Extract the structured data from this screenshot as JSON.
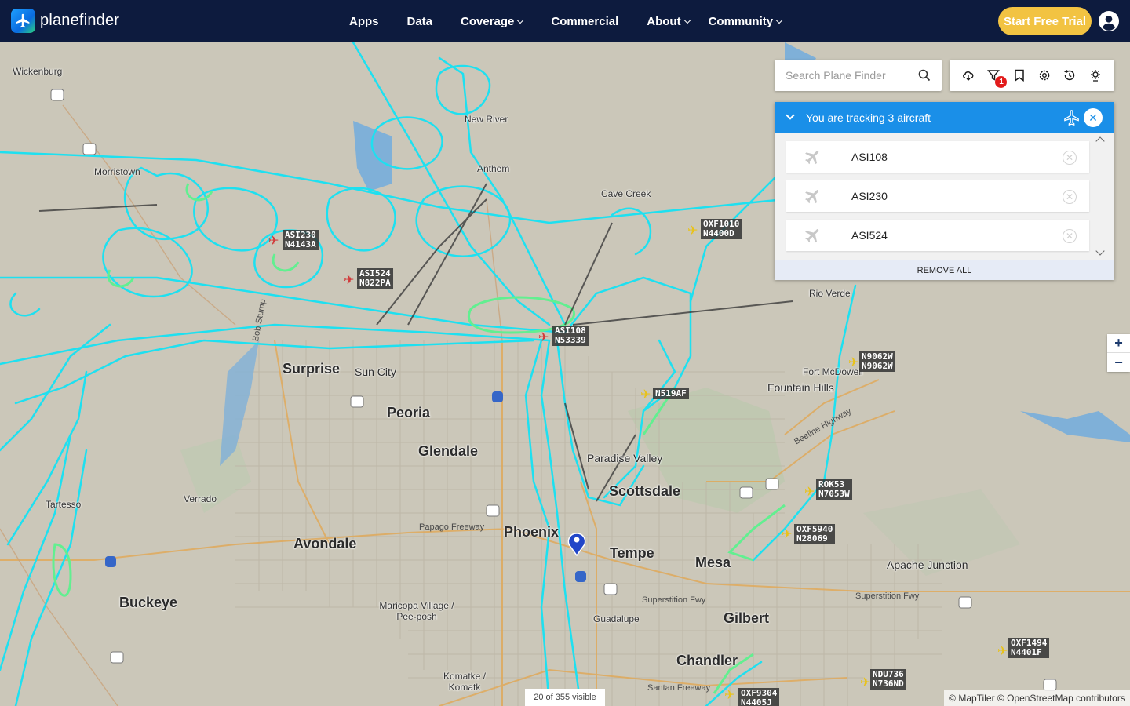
{
  "header": {
    "brand": "planefinder",
    "nav": [
      {
        "label": "Apps",
        "dropdown": false
      },
      {
        "label": "Data",
        "dropdown": false
      },
      {
        "label": "Coverage",
        "dropdown": true
      },
      {
        "label": "Commercial",
        "dropdown": false
      },
      {
        "label": "About",
        "dropdown": true
      },
      {
        "label": "Community",
        "dropdown": true
      }
    ],
    "trial_button": "Start Free Trial",
    "account_icon": "user-circle-icon"
  },
  "search": {
    "placeholder": "Search Plane Finder"
  },
  "toolbar": {
    "icons": [
      "cloud-icon",
      "filter-icon",
      "bookmark-icon",
      "settings-icon",
      "history-icon",
      "weather-icon"
    ],
    "filter_badge": "1"
  },
  "tracking": {
    "title": "You are tracking 3 aircraft",
    "items": [
      {
        "label": "ASI108"
      },
      {
        "label": "ASI230"
      },
      {
        "label": "ASI524"
      }
    ],
    "remove_all": "REMOVE ALL"
  },
  "map": {
    "cities": [
      {
        "name": "Wickenburg",
        "size": "small"
      },
      {
        "name": "New River",
        "size": "small"
      },
      {
        "name": "Morristown",
        "size": "small"
      },
      {
        "name": "Anthem",
        "size": "small"
      },
      {
        "name": "Cave Creek",
        "size": "small"
      },
      {
        "name": "Rio Verde",
        "size": "small"
      },
      {
        "name": "Fort McDowell",
        "size": "small"
      },
      {
        "name": "Fountain Hills",
        "size": "mid"
      },
      {
        "name": "Surprise",
        "size": "big"
      },
      {
        "name": "Sun City",
        "size": "mid"
      },
      {
        "name": "Peoria",
        "size": "big"
      },
      {
        "name": "Glendale",
        "size": "big"
      },
      {
        "name": "Paradise Valley",
        "size": "mid"
      },
      {
        "name": "Scottsdale",
        "size": "big"
      },
      {
        "name": "Tartesso",
        "size": "small"
      },
      {
        "name": "Verrado",
        "size": "small"
      },
      {
        "name": "Avondale",
        "size": "big"
      },
      {
        "name": "Phoenix",
        "size": "big"
      },
      {
        "name": "Tempe",
        "size": "big"
      },
      {
        "name": "Mesa",
        "size": "big"
      },
      {
        "name": "Apache Junction",
        "size": "mid"
      },
      {
        "name": "Buckeye",
        "size": "big"
      },
      {
        "name": "Maricopa Village / Pee-posh",
        "size": "small"
      },
      {
        "name": "Guadalupe",
        "size": "small"
      },
      {
        "name": "Gilbert",
        "size": "big"
      },
      {
        "name": "Chandler",
        "size": "big"
      },
      {
        "name": "Komatke / Komatk",
        "size": "small"
      }
    ],
    "road_labels": [
      "Papago Freeway",
      "Superstition Fwy",
      "Superstition Fwy",
      "Santan Freeway",
      "Bob Stump",
      "Beeline Highway"
    ],
    "aircraft": [
      {
        "callsign": "ASI230",
        "reg": "N4143A",
        "color": "#d13b3b"
      },
      {
        "callsign": "ASI524",
        "reg": "N822PA",
        "color": "#d13b3b"
      },
      {
        "callsign": "ASI108",
        "reg": "N53339",
        "color": "#d13b3b"
      },
      {
        "callsign": "OXF1010",
        "reg": "N4400D",
        "color": "#e8c21a"
      },
      {
        "callsign": "N9062W",
        "reg": "N9062W",
        "color": "#e8c21a"
      },
      {
        "callsign": "N519AF",
        "reg": "",
        "color": "#e8c21a"
      },
      {
        "callsign": "ROK53",
        "reg": "N7053W",
        "color": "#e8c21a"
      },
      {
        "callsign": "OXF5940",
        "reg": "N28069",
        "color": "#e8c21a"
      },
      {
        "callsign": "OXF1494",
        "reg": "N4401F",
        "color": "#e8c21a"
      },
      {
        "callsign": "NDU736",
        "reg": "N736ND",
        "color": "#e8c21a"
      },
      {
        "callsign": "OXF9304",
        "reg": "N4405J",
        "color": "#e8c21a"
      }
    ],
    "track_color": "#19e3f0",
    "track_color_low": "#5cf08a",
    "visible_count": "20 of 355 visible",
    "attribution": "© MapTiler © OpenStreetMap contributors"
  }
}
